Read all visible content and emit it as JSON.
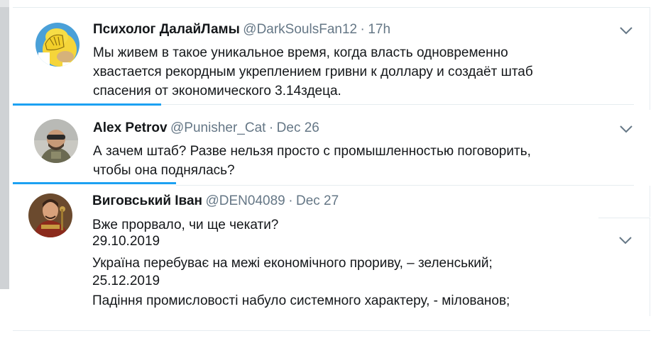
{
  "tweets": [
    {
      "display_name": "Психолог ДалайЛамы",
      "handle": "@DarkSoulsFan12",
      "dot": "·",
      "time": "17h",
      "lines": [
        "Мы живем в такое уникальное время, когда власть одновременно",
        "хвастается рекордным укреплением гривни к доллару и создаёт штаб",
        "спасения от экономического 3.14здеца."
      ]
    },
    {
      "display_name": "Alex Petrov",
      "handle": "@Punisher_Cat",
      "dot": "·",
      "time": "Dec 26",
      "lines": [
        "А зачем штаб? Разве нельзя просто с промышленностью поговорить,",
        "чтобы она поднялась?"
      ]
    },
    {
      "display_name": "Виговський Іван",
      "handle": "@DEN04089",
      "dot": "·",
      "time": "Dec 27",
      "lines": [
        "Вже прорвало, чи ще чекати?",
        "29.10.2019",
        "Україна перебуває на межі економічного прориву, – зеленський;",
        "25.12.2019",
        "Падіння промисловості набуло системного характеру, - мілованов;"
      ]
    }
  ],
  "icons": {
    "more": "chevron-down-icon"
  },
  "colors": {
    "accent": "#1da1f2",
    "muted": "#657786",
    "text": "#14171a"
  }
}
